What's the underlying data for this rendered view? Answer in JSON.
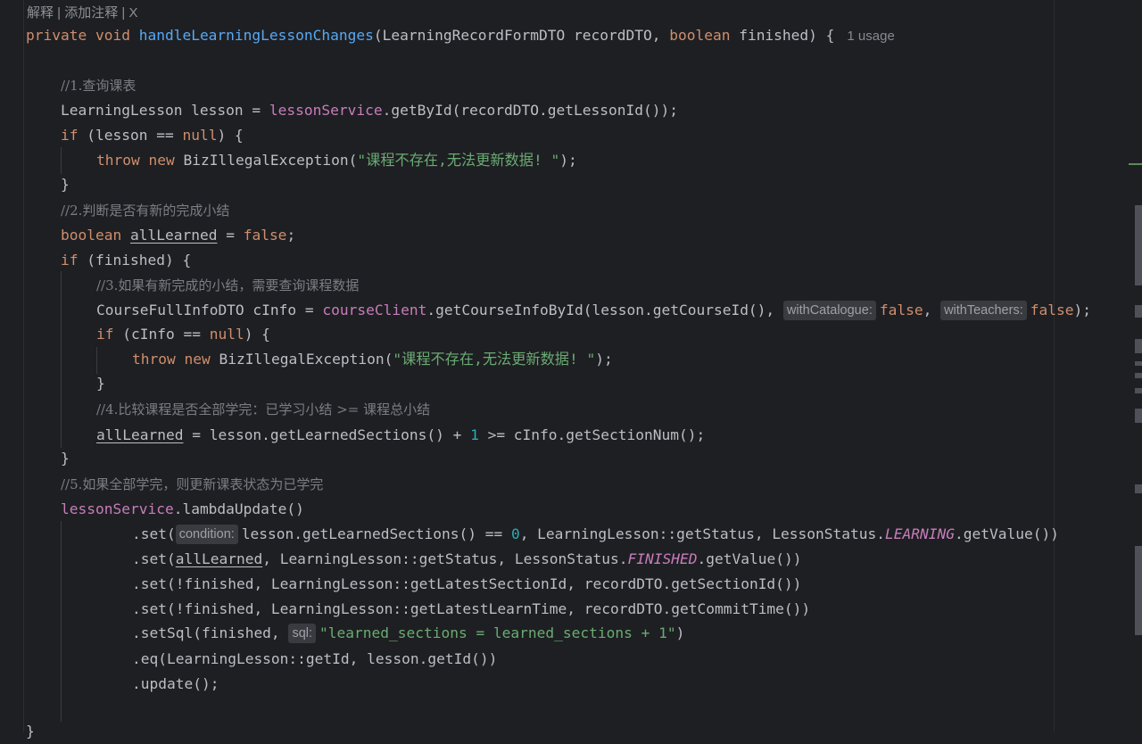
{
  "hints": {
    "top_actions": "解释 | 添加注释 | X",
    "usage": "1 usage",
    "with_catalogue": "withCatalogue:",
    "with_teachers": "withTeachers:",
    "condition": "condition:",
    "sql": "sql:"
  },
  "code": {
    "sig_private": "private",
    "sig_void": "void",
    "sig_method": "handleLearningLessonChanges",
    "sig_params_a": "(LearningRecordFormDTO recordDTO, ",
    "sig_boolean": "boolean",
    "sig_params_b": " finished) {",
    "c1": "//1.查询课表",
    "l1_a": "LearningLesson lesson = ",
    "l1_field": "lessonService",
    "l1_b": ".getById(recordDTO.getLessonId());",
    "if1_kw": "if",
    "if1_a": " (lesson == ",
    "null_kw": "null",
    "if1_b": ") {",
    "throw_kw": "throw",
    "new_kw": "new",
    "exc_class": " BizIllegalException(",
    "exc_msg": "\"课程不存在,无法更新数据! \"",
    "exc_end": ");",
    "close_brace": "}",
    "c2": "//2.判断是否有新的完成小结",
    "bool_kw": "boolean",
    "var_all": "allLearned",
    "eq_sign": " = ",
    "false_kw": "false",
    "semi": ";",
    "if2_a": " (finished) {",
    "c3": "//3.如果有新完成的小结，需要查询课程数据",
    "l3_a": "CourseFullInfoDTO cInfo = ",
    "l3_field": "courseClient",
    "l3_b": ".getCourseInfoById(lesson.getCourseId(), ",
    "comma_sp": ", ",
    "l3_end": ");",
    "if3_a": " (cInfo == ",
    "c4": "//4.比较课程是否全部学完：已学习小结 >= 课程总小结",
    "l4_a": " = lesson.getLearnedSections() + ",
    "num_one": "1",
    "l4_b": " >= cInfo.getSectionNum();",
    "c5": "//5.如果全部学完，则更新课表状态为已学完",
    "l5_field": "lessonService",
    "l5_b": ".lambdaUpdate()",
    "s1_a": ".set(",
    "s1_b": "lesson.getLearnedSections() == ",
    "num_zero": "0",
    "s1_c": ", LearningLesson::getStatus, LessonStatus.",
    "const_learning": "LEARNING",
    "get_value_end": ".getValue())",
    "s2_a": ".set(",
    "s2_b": ", LearningLesson::getStatus, LessonStatus.",
    "const_finished": "FINISHED",
    "s3": ".set(!finished, LearningLesson::getLatestSectionId, recordDTO.getSectionId())",
    "s4": ".set(!finished, LearningLesson::getLatestLearnTime, recordDTO.getCommitTime())",
    "s5_a": ".setSql(finished, ",
    "s5_str": "\"learned_sections = learned_sections + 1\"",
    "s5_end": ")",
    "s6": ".eq(LearningLesson::getId, lesson.getId())",
    "s7": ".update();",
    "final_brace": "}"
  },
  "colors": {
    "background": "#1e1f22",
    "keyword": "#cf8e6d",
    "method": "#56a8f5",
    "field": "#c77dbb",
    "string": "#6aab73",
    "number": "#2aacb8",
    "comment": "#7a7e85",
    "text": "#bcbec4"
  }
}
